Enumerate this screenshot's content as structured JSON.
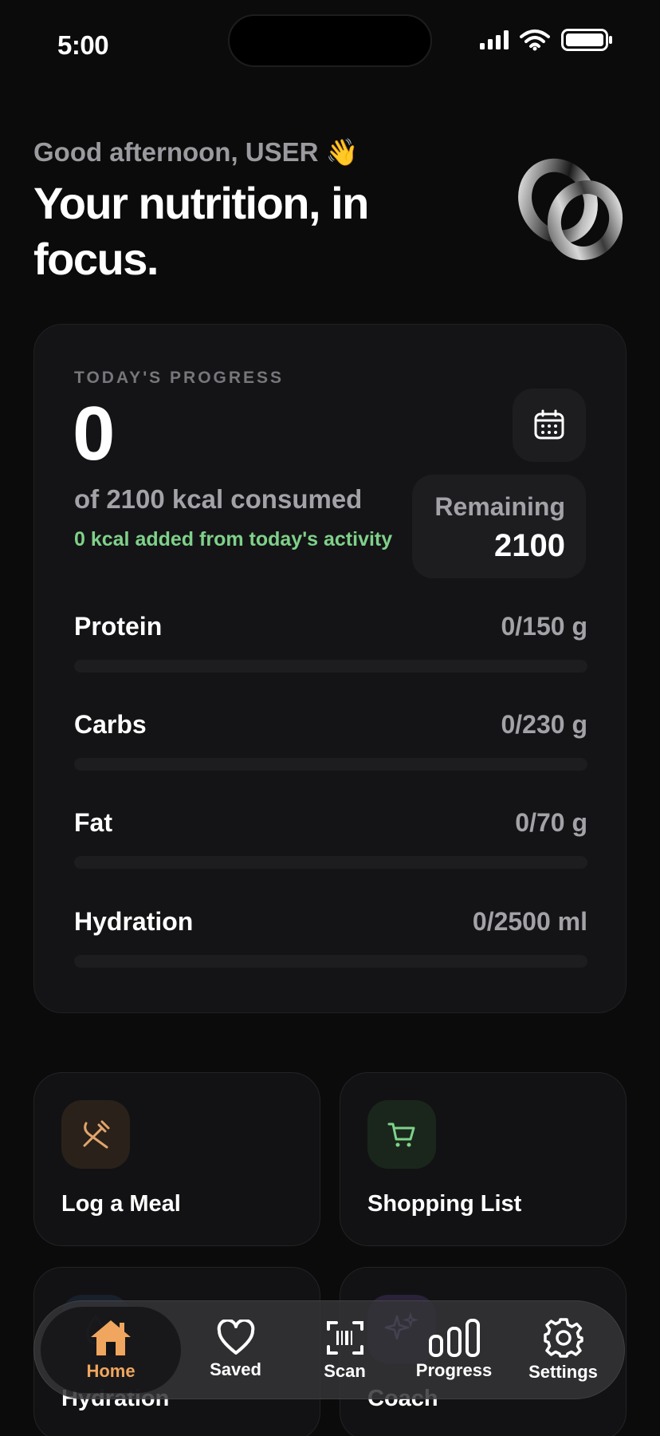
{
  "status": {
    "time": "5:00"
  },
  "header": {
    "greeting": "Good afternoon, USER 👋",
    "headline": "Your nutrition, in focus."
  },
  "progress": {
    "label": "TODAY'S PROGRESS",
    "consumed_value": "0",
    "consumed_text": "of 2100 kcal consumed",
    "activity_text": "0 kcal added from today's activity",
    "remaining_label": "Remaining",
    "remaining_value": "2100",
    "macros": [
      {
        "name": "Protein",
        "value": "0/150 g",
        "progress": 0
      },
      {
        "name": "Carbs",
        "value": "0/230 g",
        "progress": 0
      },
      {
        "name": "Fat",
        "value": "0/70 g",
        "progress": 0
      },
      {
        "name": "Hydration",
        "value": "0/2500 ml",
        "progress": 0
      }
    ]
  },
  "actions": [
    {
      "label": "Log a Meal",
      "icon": "fork-knife-icon",
      "color": "#e0a56b"
    },
    {
      "label": "Shopping List",
      "icon": "cart-icon",
      "color": "#7fd18a"
    },
    {
      "label": "Hydration",
      "icon": "water-drop-icon",
      "color": "#6b9be0"
    },
    {
      "label": "Coach",
      "icon": "sparkles-icon",
      "color": "#a58be0"
    }
  ],
  "tabs": [
    {
      "label": "Home",
      "icon": "home-icon",
      "active": true
    },
    {
      "label": "Saved",
      "icon": "heart-icon",
      "active": false
    },
    {
      "label": "Scan",
      "icon": "barcode-scan-icon",
      "active": false
    },
    {
      "label": "Progress",
      "icon": "bar-chart-icon",
      "active": false
    },
    {
      "label": "Settings",
      "icon": "gear-icon",
      "active": false
    }
  ],
  "colors": {
    "accent": "#f0a65e",
    "positive": "#7fd18a",
    "background": "#0b0b0c",
    "card": "#141416"
  }
}
